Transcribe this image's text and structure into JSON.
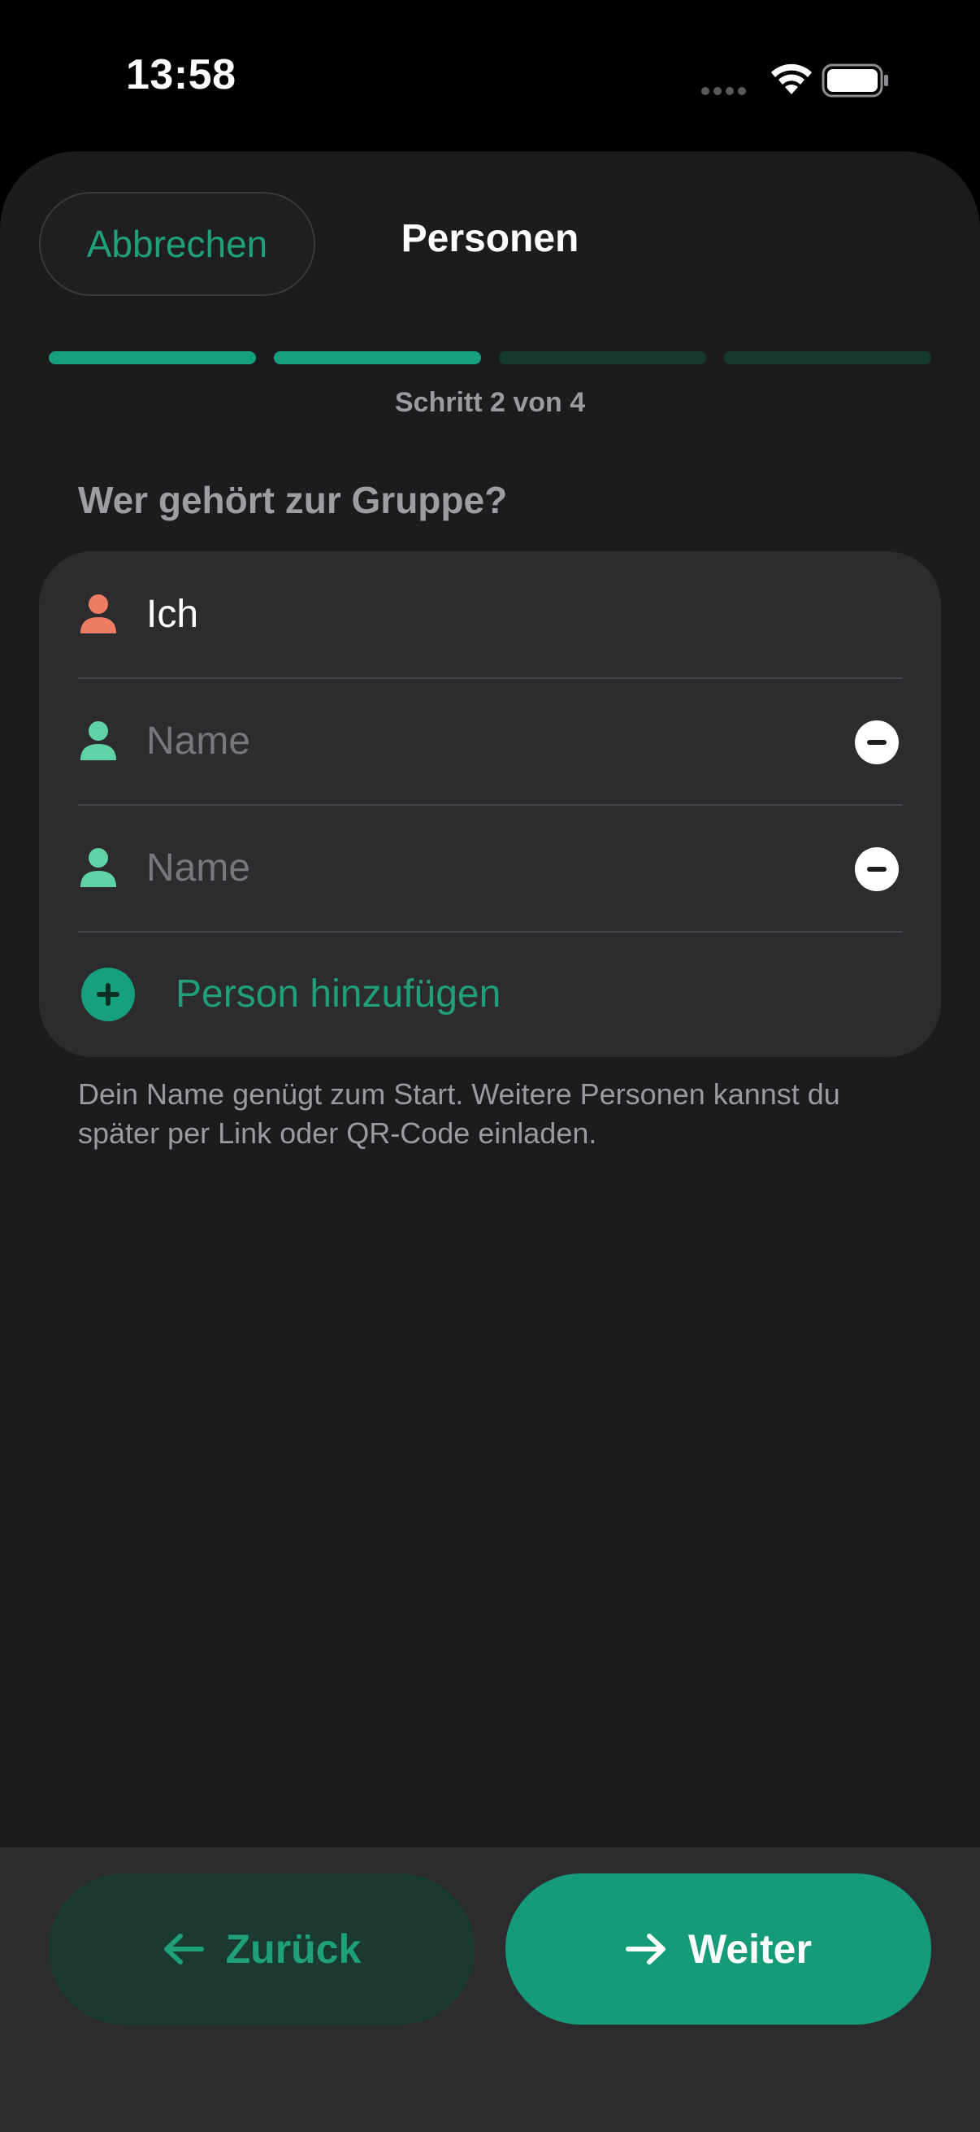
{
  "status_bar": {
    "time": "13:58",
    "icons": [
      "signal-icon",
      "wifi-icon",
      "battery-icon"
    ]
  },
  "header": {
    "cancel_label": "Abbrechen",
    "title": "Personen"
  },
  "progress": {
    "current_step": 2,
    "total_steps": 4,
    "label": "Schritt 2 von 4"
  },
  "section": {
    "heading": "Wer gehört zur Gruppe?"
  },
  "members": [
    {
      "value": "Ich",
      "placeholder": "",
      "icon": "person-icon",
      "icon_color": "#f07c66",
      "removable": false
    },
    {
      "value": "",
      "placeholder": "Name",
      "icon": "person-icon",
      "icon_color": "#5fd3a5",
      "removable": true
    },
    {
      "value": "",
      "placeholder": "Name",
      "icon": "person-icon",
      "icon_color": "#5fd3a5",
      "removable": true
    }
  ],
  "add_person_label": "Person hinzufügen",
  "helper_text": "Dein Name genügt zum Start. Weitere Personen kannst du später per Link oder QR-Code einladen.",
  "footer": {
    "back_label": "Zurück",
    "next_label": "Weiter"
  },
  "colors": {
    "accent": "#17a07c",
    "background": "#1c1c1e",
    "card": "#2c2c2e",
    "self_icon": "#f07c66",
    "member_icon": "#5fd3a5"
  }
}
